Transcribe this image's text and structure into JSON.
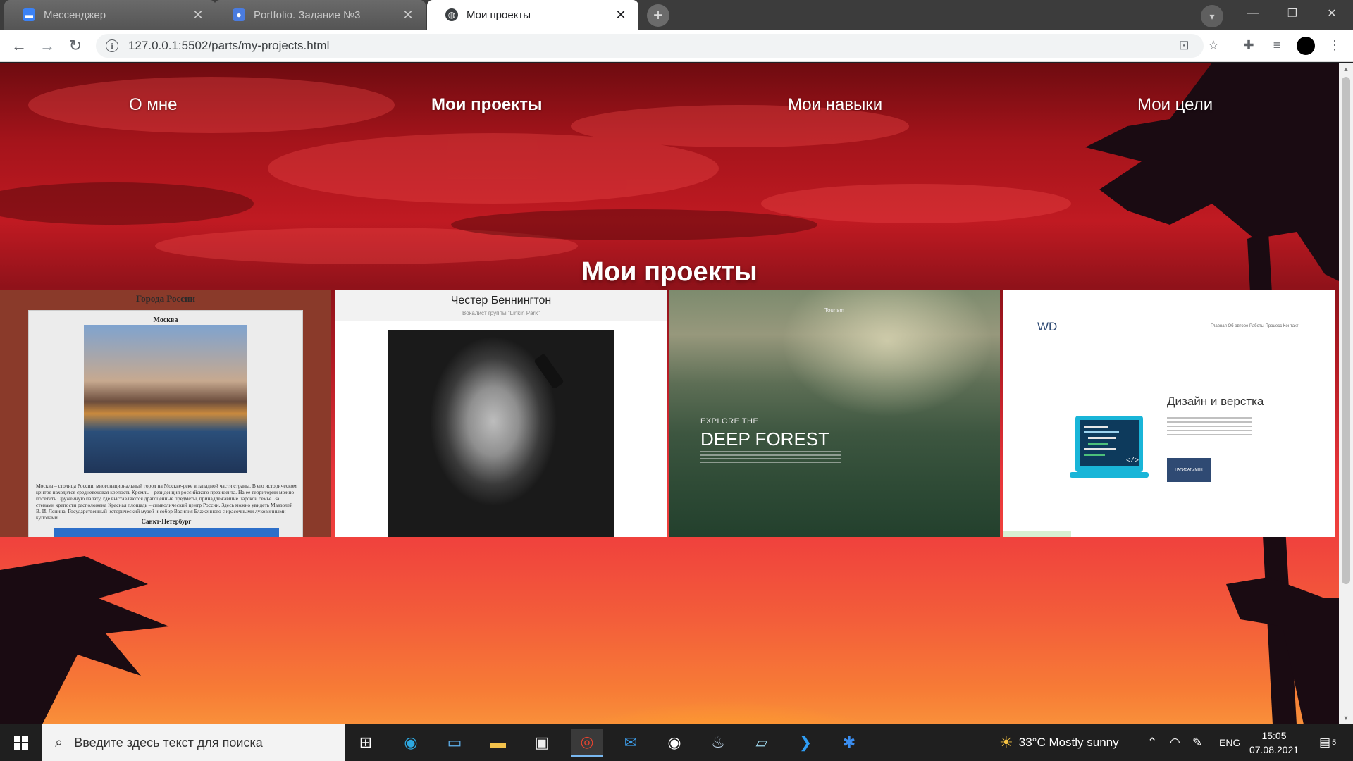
{
  "browser": {
    "tabs": [
      {
        "title": "Мессенджер",
        "active": false
      },
      {
        "title": "Portfolio. Задание №3",
        "active": false
      },
      {
        "title": "Мои проекты",
        "active": true
      }
    ],
    "url": "127.0.0.1:5502/parts/my-projects.html"
  },
  "page": {
    "nav": [
      "О мне",
      "Мои проекты",
      "Мои навыки",
      "Мои цели"
    ],
    "current_nav": "Мои проекты",
    "section_title": "Мои проекты",
    "projects": [
      {
        "header": "Города России",
        "subheader": "Москва",
        "paragraph": "Москва – столица России, многонациональный город на Москве-реке в западной части страны. В его историческом центре находится средневековая крепость Кремль – резиденция российского президента. На ее территории можно посетить Оружейную палату, где выставляются драгоценные предметы, принадлежавшие царской семье. За стенами крепости расположена Красная площадь – символический центр России. Здесь можно увидеть Мавзолей В. И. Ленина, Государственный исторический музей и собор Василия Блаженного с красочными луковичными куполами.",
        "subheader2": "Санкт-Петербург"
      },
      {
        "header": "Честер Беннингтон",
        "subheader": "Вокалист группы \"Linkin Park\""
      },
      {
        "brand": "Tourism",
        "kicker": "EXPLORE THE",
        "headline": "DEEP FOREST"
      },
      {
        "logo": "WD",
        "menu": "Главная   Об авторе   Работы   Процесс   Контакт",
        "heading": "Дизайн и верстка",
        "button": "НАПИСАТЬ МНЕ"
      }
    ]
  },
  "taskbar": {
    "search_placeholder": "Введите здесь текст для поиска",
    "weather": "33°C  Mostly sunny",
    "language": "ENG",
    "time": "15:05",
    "date": "07.08.2021",
    "notifications": "5"
  }
}
